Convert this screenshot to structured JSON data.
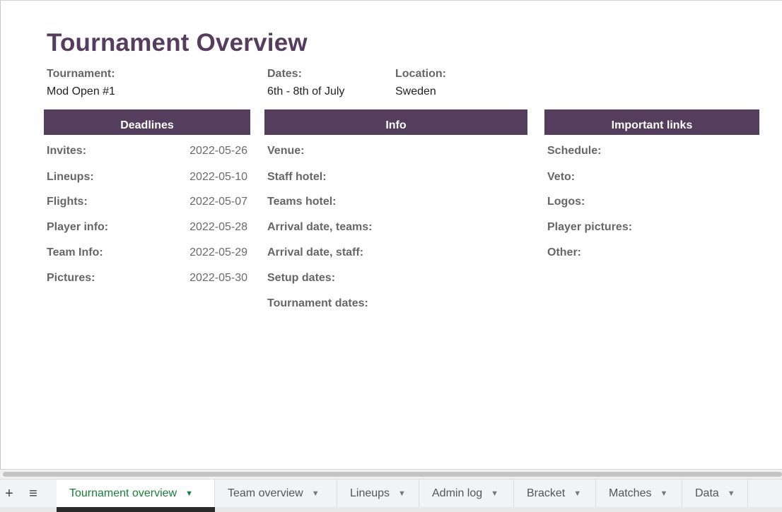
{
  "title": "Tournament Overview",
  "meta": {
    "tournament_label": "Tournament:",
    "tournament_value": "Mod Open #1",
    "dates_label": "Dates:",
    "dates_value": "6th - 8th of July",
    "location_label": "Location:",
    "location_value": "Sweden"
  },
  "deadlines": {
    "header": "Deadlines",
    "rows": [
      {
        "label": "Invites:",
        "value": "2022-05-26"
      },
      {
        "label": "Lineups:",
        "value": "2022-05-10"
      },
      {
        "label": "Flights:",
        "value": "2022-05-07"
      },
      {
        "label": "Player info:",
        "value": "2022-05-28"
      },
      {
        "label": "Team Info:",
        "value": "2022-05-29"
      },
      {
        "label": "Pictures:",
        "value": "2022-05-30"
      }
    ]
  },
  "info": {
    "header": "Info",
    "rows": [
      {
        "label": "Venue:"
      },
      {
        "label": "Staff hotel:"
      },
      {
        "label": "Teams hotel:"
      },
      {
        "label": "Arrival date, teams:"
      },
      {
        "label": "Arrival date, staff:"
      },
      {
        "label": "Setup dates:"
      },
      {
        "label": "Tournament dates:"
      }
    ]
  },
  "links": {
    "header": "Important links",
    "rows": [
      {
        "label": "Schedule:"
      },
      {
        "label": "Veto:"
      },
      {
        "label": "Logos:"
      },
      {
        "label": "Player pictures:"
      },
      {
        "label": "Other:"
      }
    ]
  },
  "tabs": [
    {
      "label": "Tournament overview",
      "active": true
    },
    {
      "label": "Team overview"
    },
    {
      "label": "Lineups"
    },
    {
      "label": "Admin log"
    },
    {
      "label": "Bracket"
    },
    {
      "label": "Matches"
    },
    {
      "label": "Data"
    }
  ],
  "icons": {
    "add_sheet": "plus-icon",
    "all_sheets": "list-icon",
    "tab_menu": "caret-down-icon"
  },
  "colors": {
    "accent": "#553d5e",
    "active_tab": "#188038"
  }
}
